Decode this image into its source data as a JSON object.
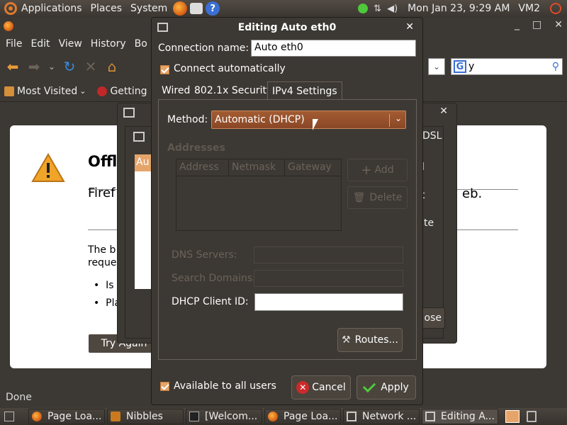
{
  "top_panel": {
    "menus": [
      "Applications",
      "Places",
      "System"
    ],
    "clock": "Mon Jan 23,  9:29 AM",
    "user": "VM2"
  },
  "firefox": {
    "menubar": [
      "File",
      "Edit",
      "View",
      "History",
      "Bo"
    ],
    "search_text": "y",
    "bookmarks": [
      "Most Visited",
      "Getting St"
    ],
    "error_title": "Offl",
    "error_sub": "Firef",
    "error_sub_right": "eb.",
    "error_body": [
      "The b",
      "reque"
    ],
    "bullets": [
      "Is t",
      "Pla"
    ],
    "try_again": "Try Again",
    "status": "Done"
  },
  "network_window": {
    "selected_item": "Au",
    "tab_dsl": "DSL",
    "side_labels": [
      "d",
      "t",
      "te"
    ],
    "close_label": "ose"
  },
  "edit_dialog": {
    "title": "Editing Auto eth0",
    "connection_name_label": "Connection name:",
    "connection_name_value": "Auto eth0",
    "connect_auto_label": "Connect automatically",
    "tabs": [
      "Wired",
      "802.1x Security",
      "IPv4 Settings"
    ],
    "method_label": "Method:",
    "method_value": "Automatic (DHCP)",
    "addresses_title": "Addresses",
    "columns": [
      "Address",
      "Netmask",
      "Gateway"
    ],
    "add_label": "Add",
    "delete_label": "Delete",
    "dns_label": "DNS Servers:",
    "search_domains_label": "Search Domains:",
    "dhcp_client_label": "DHCP Client ID:",
    "dhcp_client_value": "",
    "routes_label": "Routes...",
    "available_label": "Available to all users",
    "cancel_label": "Cancel",
    "apply_label": "Apply"
  },
  "taskbar": [
    {
      "label": "Page Loa...",
      "icon": "firefox-icon"
    },
    {
      "label": "Nibbles",
      "icon": "game-icon"
    },
    {
      "label": "[Welcom...",
      "icon": "terminal-icon"
    },
    {
      "label": "Page Loa...",
      "icon": "firefox-icon"
    },
    {
      "label": "Network ...",
      "icon": "network-icon"
    },
    {
      "label": "Editing A...",
      "icon": "network-icon"
    }
  ]
}
